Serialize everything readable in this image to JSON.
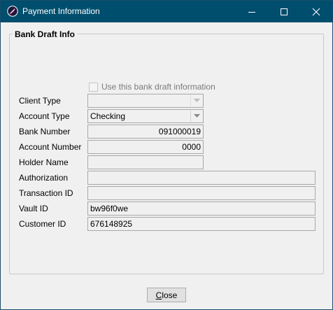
{
  "window": {
    "title": "Payment Information"
  },
  "group": {
    "title": "Bank Draft Info"
  },
  "use_bank_draft": {
    "label": "Use this bank draft information",
    "checked": false
  },
  "fields": {
    "client_type": {
      "label": "Client Type",
      "value": ""
    },
    "account_type": {
      "label": "Account Type",
      "value": "Checking"
    },
    "bank_number": {
      "label": "Bank Number",
      "value": "091000019"
    },
    "account_number": {
      "label": "Account Number",
      "value": "0000"
    },
    "holder_name": {
      "label": "Holder Name",
      "value": ""
    },
    "authorization": {
      "label": "Authorization",
      "value": ""
    },
    "transaction_id": {
      "label": "Transaction ID",
      "value": ""
    },
    "vault_id": {
      "label": "Vault ID",
      "value": "bw96f0we"
    },
    "customer_id": {
      "label": "Customer ID",
      "value": "676148925"
    }
  },
  "footer": {
    "close_mnemonic": "C",
    "close_rest": "lose"
  },
  "colors": {
    "titlebar": "#004e6e",
    "dialog_bg": "#f0f0f0"
  }
}
